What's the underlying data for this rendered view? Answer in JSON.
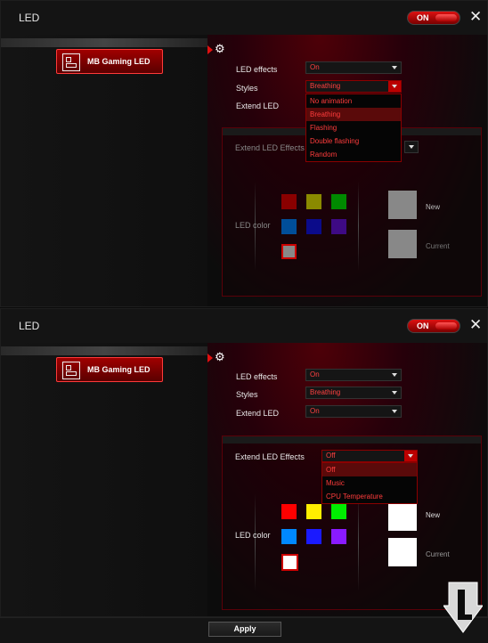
{
  "panels": [
    {
      "title": "LED",
      "power_toggle": "ON",
      "sidebar_item": "MB Gaming LED",
      "led_effects": {
        "label": "LED effects",
        "value": "On"
      },
      "styles": {
        "label": "Styles",
        "value": "Breathing",
        "options": [
          "No animation",
          "Breathing",
          "Flashing",
          "Double flashing",
          "Random"
        ],
        "selected_index": 1
      },
      "extend_led": {
        "label": "Extend LED"
      },
      "extend_led_effects": {
        "label": "Extend LED Effects"
      },
      "led_color_label": "LED color",
      "swatches": [
        "#8a0000",
        "#8a8a00",
        "#008a00",
        "#004e99",
        "#0b0b8a",
        "#3e0a84"
      ],
      "custom_swatch": "#888888",
      "new_label": "New",
      "current_label": "Current",
      "new_color": "#888888",
      "current_color": "#888888"
    },
    {
      "title": "LED",
      "power_toggle": "ON",
      "sidebar_item": "MB Gaming LED",
      "led_effects": {
        "label": "LED effects",
        "value": "On"
      },
      "styles": {
        "label": "Styles",
        "value": "Breathing"
      },
      "extend_led": {
        "label": "Extend LED",
        "value": "On"
      },
      "extend_led_effects": {
        "label": "Extend LED Effects",
        "value": "Off",
        "options": [
          "Off",
          "Music",
          "CPU Temperature"
        ],
        "selected_index": 0
      },
      "led_color_label": "LED color",
      "swatches": [
        "#ff0000",
        "#ffee00",
        "#00ee00",
        "#0088ff",
        "#1a1aff",
        "#8a1aff"
      ],
      "custom_swatch": "#ffffff",
      "new_label": "New",
      "current_label": "Current",
      "new_color": "#ffffff",
      "current_color": "#ffffff"
    }
  ],
  "apply_button": "Apply"
}
